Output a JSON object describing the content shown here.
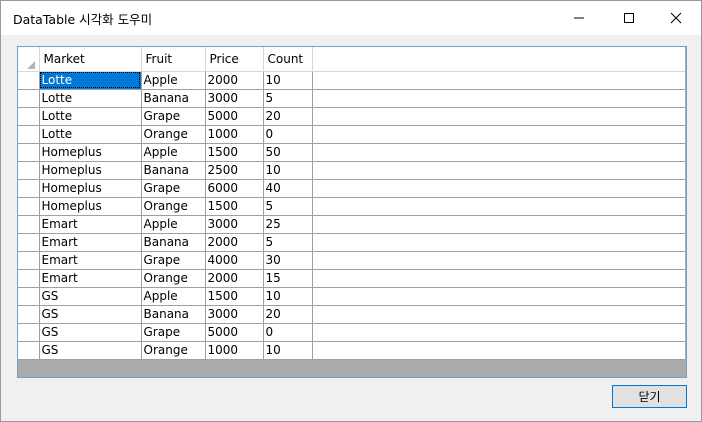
{
  "window": {
    "title": "DataTable 시각화 도우미",
    "close_button_label": "닫기"
  },
  "grid": {
    "columns": [
      "Market",
      "Fruit",
      "Price",
      "Count"
    ],
    "rows": [
      [
        "Lotte",
        "Apple",
        "2000",
        "10"
      ],
      [
        "Lotte",
        "Banana",
        "3000",
        "5"
      ],
      [
        "Lotte",
        "Grape",
        "5000",
        "20"
      ],
      [
        "Lotte",
        "Orange",
        "1000",
        "0"
      ],
      [
        "Homeplus",
        "Apple",
        "1500",
        "50"
      ],
      [
        "Homeplus",
        "Banana",
        "2500",
        "10"
      ],
      [
        "Homeplus",
        "Grape",
        "6000",
        "40"
      ],
      [
        "Homeplus",
        "Orange",
        "1500",
        "5"
      ],
      [
        "Emart",
        "Apple",
        "3000",
        "25"
      ],
      [
        "Emart",
        "Banana",
        "2000",
        "5"
      ],
      [
        "Emart",
        "Grape",
        "4000",
        "30"
      ],
      [
        "Emart",
        "Orange",
        "2000",
        "15"
      ],
      [
        "GS",
        "Apple",
        "1500",
        "10"
      ],
      [
        "GS",
        "Banana",
        "3000",
        "20"
      ],
      [
        "GS",
        "Grape",
        "5000",
        "0"
      ],
      [
        "GS",
        "Orange",
        "1000",
        "10"
      ]
    ],
    "selected_cell": {
      "row": 0,
      "col": 0
    }
  },
  "colors": {
    "selection": "#0078d7",
    "grid_background": "#ababab",
    "button_border": "#0078d7"
  },
  "icons": {
    "minimize": "minimize-icon",
    "maximize": "maximize-icon",
    "close": "close-icon",
    "corner": "select-all-corner-icon"
  }
}
